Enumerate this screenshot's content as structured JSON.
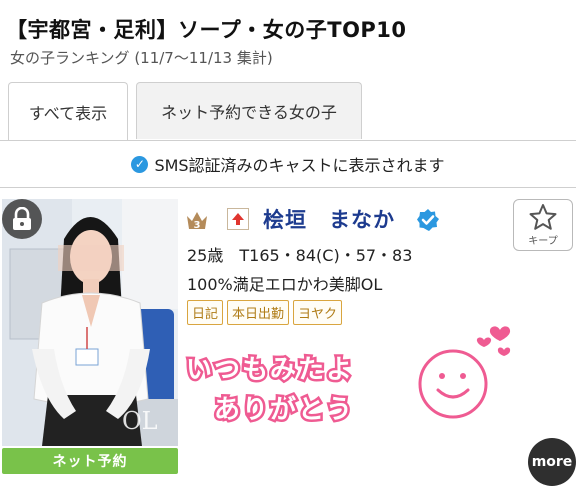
{
  "header": {
    "title": "【宇都宮・足利】ソープ・女の子TOP10",
    "subtitle": "女の子ランキング (11/7〜11/13 集計)"
  },
  "tabs": [
    {
      "label": "すべて表示",
      "active": true
    },
    {
      "label": "ネット予約できる女の子",
      "active": false
    }
  ],
  "notice": {
    "text": "SMS認証済みのキャストに表示されます",
    "icon": "check-badge-icon"
  },
  "card": {
    "rank": "3",
    "rank_change": "up",
    "name": "桧垣　まなか",
    "verified": true,
    "stats": "25歳　T165・84(C)・57・83",
    "catch_copy": "100%満足エロかわ美脚OL",
    "tags": [
      "日記",
      "本日出勤",
      "ヨヤク"
    ],
    "keep_label": "キープ",
    "reserve_label": "ネット予約",
    "photo_overlay": "OL",
    "handwritten_message": "いつもみたよ ありがとう",
    "more_label": "more"
  },
  "colors": {
    "accent_blue": "#2b98e0",
    "name_color": "#1d3b8f",
    "reserve_green": "#79c24a",
    "tag_gold": "#d9a53f",
    "message_pink": "#ef5b92"
  }
}
